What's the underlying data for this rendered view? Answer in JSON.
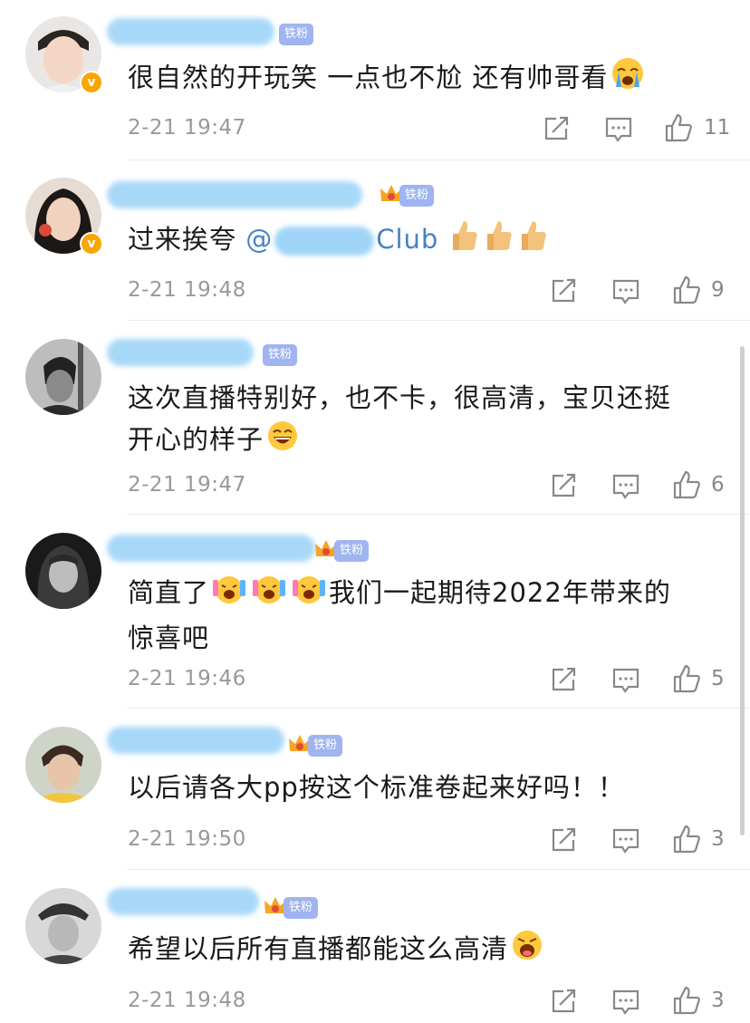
{
  "comments": [
    {
      "name_hidden": true,
      "fan_badge": "铁粉",
      "text": "很自然的开玩笑 一点也不尬 还有帅哥看",
      "time": "2-21 19:47",
      "likes": "11",
      "verified": true,
      "emoji_after": "crying-emoji"
    },
    {
      "fan_badge": "铁粉",
      "text_prefix": "过来挨夸 ",
      "mention_prefix": "@",
      "mention_suffix": "Club",
      "time": "2-21 19:48",
      "likes": "9",
      "verified": true,
      "emoji_after": "thumbs-up-emoji ×3"
    },
    {
      "fan_badge": "铁粉",
      "text_line1": "这次直播特别好，也不卡，很高清，宝贝还挺",
      "text_line2": "开心的样子",
      "time": "2-21 19:47",
      "likes": "6"
    },
    {
      "fan_badge": "铁粉",
      "text_prefix": "简直了",
      "text_suffix": "我们一起期待2022年带来的",
      "text_line2": "惊喜吧",
      "time": "2-21 19:46",
      "likes": "5"
    },
    {
      "fan_badge": "铁粉",
      "text": "以后请各大pp按这个标准卷起来好吗！！",
      "time": "2-21 19:50",
      "likes": "3"
    },
    {
      "fan_badge": "铁粉",
      "text": "希望以后所有直播都能这么高清",
      "time": "2-21 19:48",
      "likes": "3"
    }
  ],
  "colors": {
    "badge": "#9fb4f0",
    "verified": "#f7a600",
    "mention": "#4682c4",
    "name_blur": "#9fd4f8"
  },
  "icons": [
    "share-icon",
    "comment-icon",
    "like-icon",
    "crown-icon",
    "verified-icon"
  ]
}
